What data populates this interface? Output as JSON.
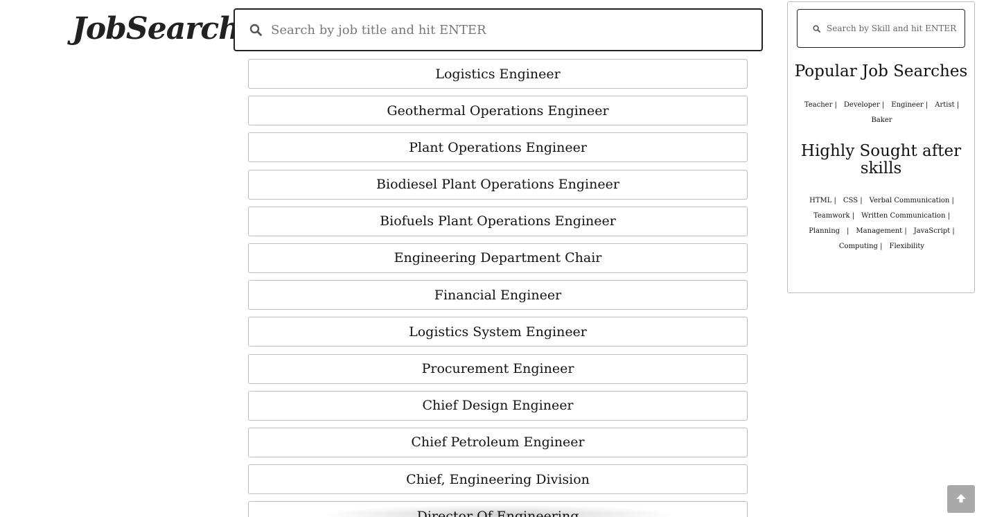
{
  "logo": {
    "text": "JobSearch"
  },
  "main_search": {
    "placeholder": "Search by job title and hit ENTER",
    "icon": "search-icon"
  },
  "jobs": [
    "Logistics Engineer",
    "Geothermal Operations Engineer",
    "Plant Operations Engineer",
    "Biodiesel Plant Operations Engineer",
    "Biofuels Plant Operations Engineer",
    "Engineering Department Chair",
    "Financial Engineer",
    "Logistics System Engineer",
    "Procurement Engineer",
    "Chief Design Engineer",
    "Chief Petroleum Engineer",
    "Chief, Engineering Division",
    "Director Of Engineering"
  ],
  "sidebar": {
    "skill_search": {
      "placeholder": "Search by Skill and hit ENTER",
      "icon": "search-icon"
    },
    "popular_heading": "Popular Job Searches",
    "popular_tags": [
      "Teacher |",
      "Developer |",
      "Engineer |",
      "Artist |",
      "Baker"
    ],
    "skills_heading": "Highly Sought after skills",
    "skill_tags": [
      "HTML |",
      "CSS |",
      "Verbal Communication |",
      "Teamwork |",
      "Written Communication |",
      "Planning",
      "|",
      "Management |",
      "JavaScript |",
      "Computing |",
      "Flexibility"
    ]
  },
  "scroll_top": {
    "icon": "arrow-up-icon",
    "color": "#a9a9a9"
  }
}
